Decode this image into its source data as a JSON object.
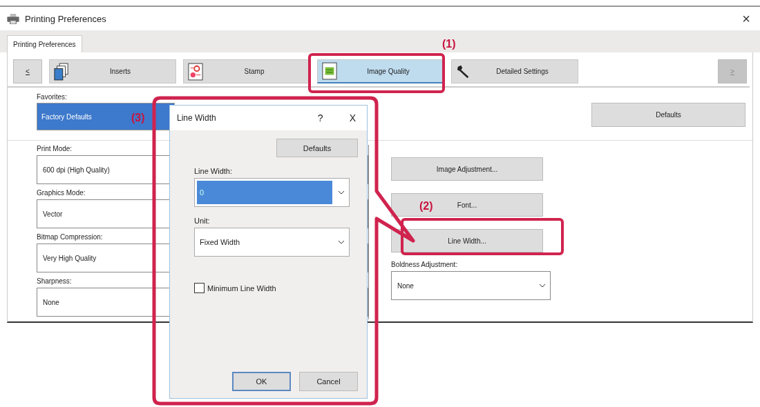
{
  "window": {
    "title": "Printing Preferences",
    "close": "×"
  },
  "tabs": [
    {
      "label": "Printing Preferences",
      "selected": true
    }
  ],
  "category_bar": {
    "prev": "<",
    "prev_disabled": false,
    "next": ">",
    "next_disabled": true,
    "items": [
      {
        "label": "Inserts",
        "kind": "pages",
        "selected": false
      },
      {
        "label": "Stamp",
        "kind": "stamp",
        "selected": false
      },
      {
        "label": "Image Quality",
        "kind": "quality",
        "selected": true
      },
      {
        "label": "Detailed Settings",
        "kind": "tool",
        "selected": false
      }
    ]
  },
  "favorites": {
    "label": "Favorites:",
    "value": "Factory Defaults",
    "selected": true
  },
  "defaults_button": "Defaults",
  "settings": [
    {
      "label": "Print Mode:",
      "value": "600 dpi (High Quality)"
    },
    {
      "label": "Graphics Mode:",
      "value": "Vector"
    },
    {
      "label": "Bitmap Compression:",
      "value": "Very High Quality"
    },
    {
      "label": "Sharpness:",
      "value": "None"
    }
  ],
  "buttons": [
    "Image Adjustment...",
    "Font...",
    "Line Width..."
  ],
  "boldness": {
    "label": "Boldness Adjustment:",
    "value": "None"
  },
  "dialog": {
    "title": "Line Width",
    "help": "?",
    "close": "X",
    "defaults": "Defaults",
    "line_width": {
      "label": "Line Width:",
      "value": "0",
      "selected": true
    },
    "unit": {
      "label": "Unit:",
      "value": "Fixed Width"
    },
    "minimum": {
      "label": "Minimum Line Width",
      "checked": false
    },
    "ok": "OK",
    "cancel": "Cancel"
  },
  "annotations": [
    {
      "label": "(1)"
    },
    {
      "label": "(2)"
    },
    {
      "label": "(3)"
    }
  ]
}
